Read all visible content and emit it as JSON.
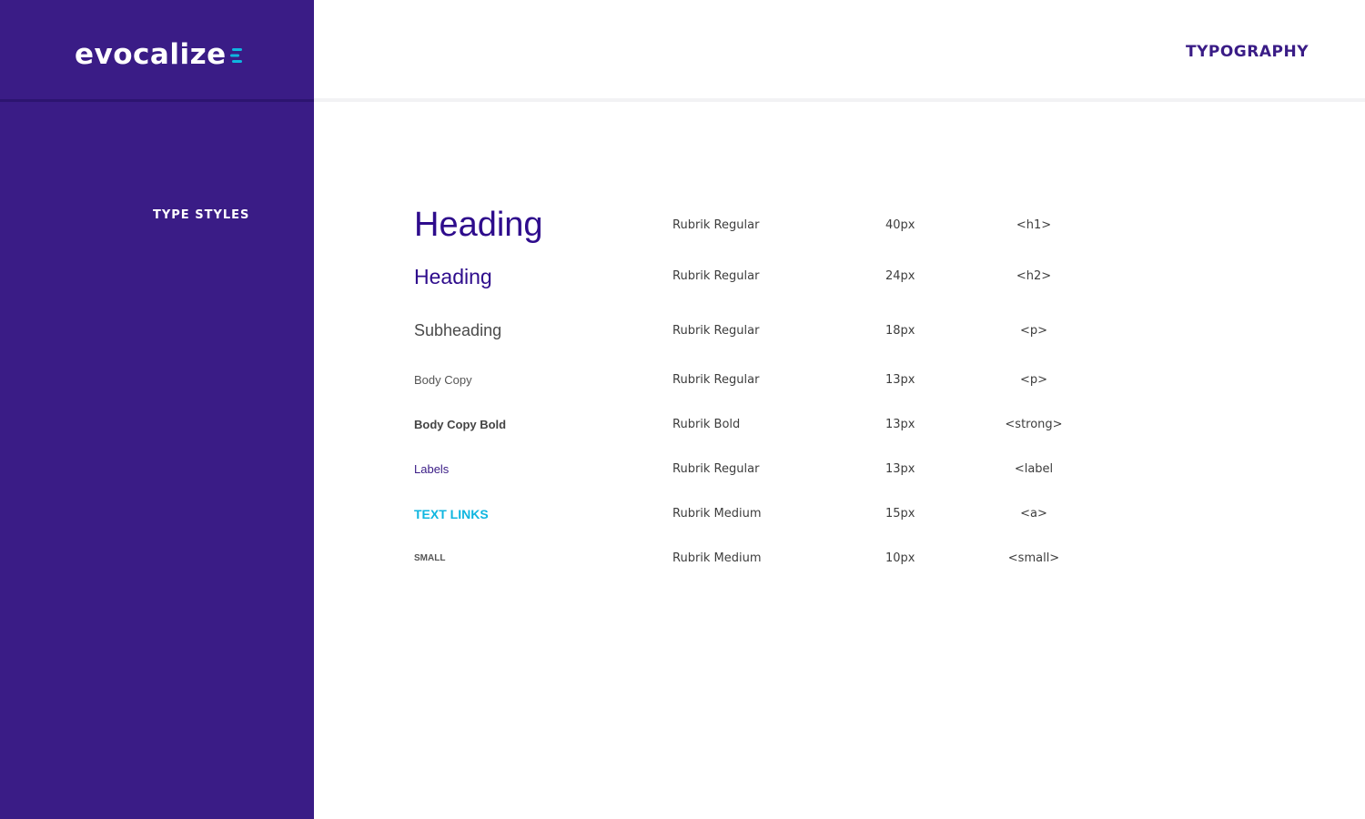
{
  "brand": {
    "logo_text": "evocalize",
    "logo_mark_icon": "triple-bar-e-icon",
    "accent_color": "#0fb6e0",
    "primary_color": "#3a1c86"
  },
  "header": {
    "title": "TYPOGRAPHY"
  },
  "sidebar": {
    "section_label": "TYPE STYLES"
  },
  "type_styles": [
    {
      "sample": "Heading",
      "font": "Rubrik Regular",
      "size": "40px",
      "tag": "<h1>"
    },
    {
      "sample": "Heading",
      "font": "Rubrik Regular",
      "size": "24px",
      "tag": "<h2>"
    },
    {
      "sample": "Subheading",
      "font": "Rubrik Regular",
      "size": "18px",
      "tag": "<p>"
    },
    {
      "sample": "Body Copy",
      "font": "Rubrik Regular",
      "size": "13px",
      "tag": "<p>"
    },
    {
      "sample": "Body Copy Bold",
      "font": "Rubrik Bold",
      "size": "13px",
      "tag": "<strong>"
    },
    {
      "sample": "Labels",
      "font": "Rubrik Regular",
      "size": "13px",
      "tag": "<label"
    },
    {
      "sample": "TEXT LINKS",
      "font": "Rubrik Medium",
      "size": "15px",
      "tag": "<a>"
    },
    {
      "sample": "SMALL",
      "font": "Rubrik Medium",
      "size": "10px",
      "tag": "<small>"
    }
  ]
}
